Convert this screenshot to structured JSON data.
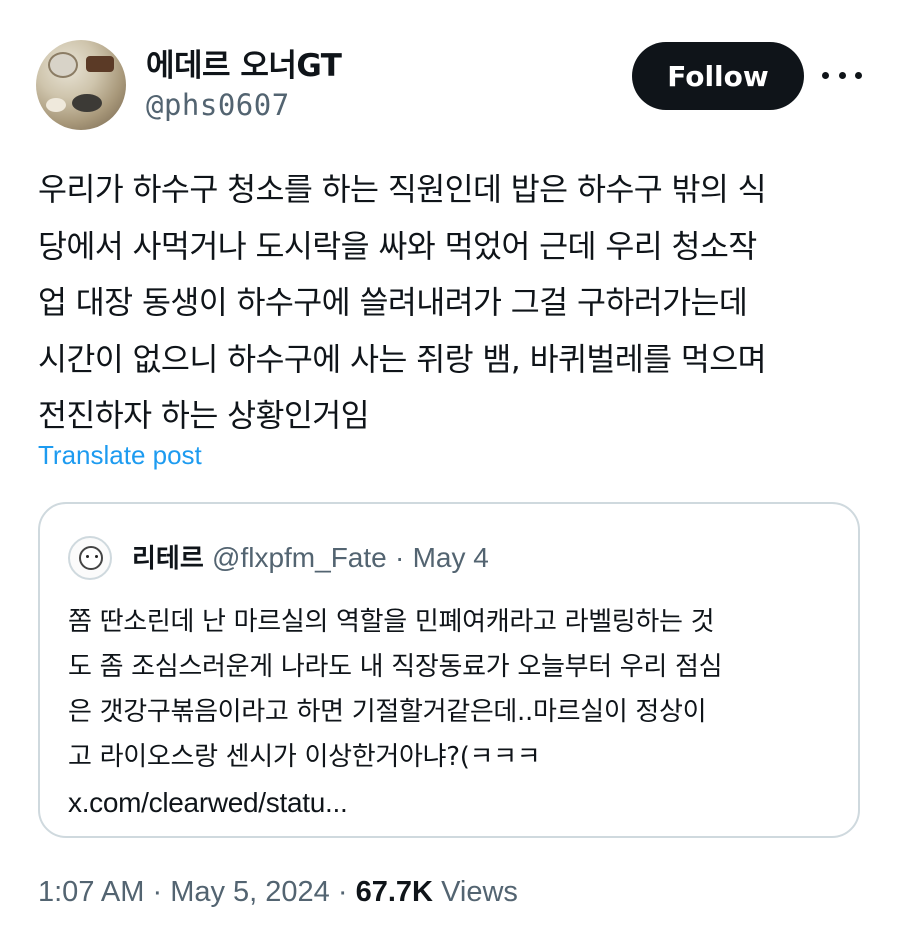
{
  "author": {
    "display_name": "에데르 오너GT",
    "handle": "@phs0607"
  },
  "actions": {
    "follow_label": "Follow",
    "more_icon": "more-horizontal-icon"
  },
  "post": {
    "lines": [
      "우리가 하수구 청소를 하는 직원인데 밥은 하수구 밖의 식",
      "당에서 사먹거나 도시락을 싸와 먹었어 근데 우리 청소작",
      "업 대장 동생이 하수구에 쓸려내려가 그걸 구하러가는데",
      "시간이 없으니 하수구에 사는 쥐랑 뱀, 바퀴벌레를 먹으며",
      "전진하자 하는 상황인거임"
    ],
    "translate_label": "Translate post"
  },
  "quote": {
    "name": "리테르",
    "handle": "@flxpfm_Fate",
    "separator": "·",
    "date": "May 4",
    "lines": [
      "쫌 딴소린데 난 마르실의 역할을 민폐여캐라고 라벨링하는 것",
      "도 좀 조심스러운게 나라도 내 직장동료가 오늘부터 우리 점심",
      "은 갯강구볶음이라고 하면 기절할거같은데..마르실이 정상이",
      "고 라이오스랑 센시가 이상한거아냐?(ㅋㅋㅋ"
    ],
    "link": "x.com/clearwed/statu..."
  },
  "footer": {
    "time": "1:07 AM",
    "separator": "·",
    "date": "May 5, 2024",
    "views_count": "67.7K",
    "views_label": "Views"
  },
  "colors": {
    "text": "#0f1419",
    "secondary": "#536471",
    "link": "#1d9bf0",
    "border": "#cfd9de",
    "button_bg": "#0f1419"
  }
}
